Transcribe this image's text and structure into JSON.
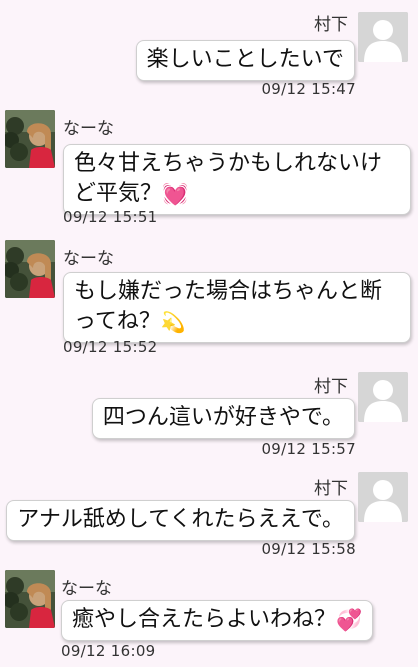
{
  "messages": [
    {
      "sender": "村下",
      "side": "right",
      "text": "楽しいことしたいで",
      "time": "09/12 15:47"
    },
    {
      "sender": "なーな",
      "side": "left",
      "text": "色々甘えちゃうかもしれないけど平気？",
      "emoji": "heart-icon",
      "time": "09/12 15:51"
    },
    {
      "sender": "なーな",
      "side": "left",
      "text": "もし嫌だった場合はちゃんと断ってね？",
      "emoji": "sparkle-icon",
      "time": "09/12 15:52"
    },
    {
      "sender": "村下",
      "side": "right",
      "text": "四つん這いが好きやで。",
      "time": "09/12 15:57"
    },
    {
      "sender": "村下",
      "side": "right",
      "text": "アナル舐めしてくれたらええで。",
      "time": "09/12 15:58"
    },
    {
      "sender": "なーな",
      "side": "left",
      "text": "癒やし合えたらよいわね？",
      "emoji": "two-hearts-icon",
      "time": "09/12 16:09"
    }
  ],
  "colors": {
    "background": "#fcf4fa",
    "bubble": "#ffffff",
    "default_avatar": "#d6d6d6"
  }
}
